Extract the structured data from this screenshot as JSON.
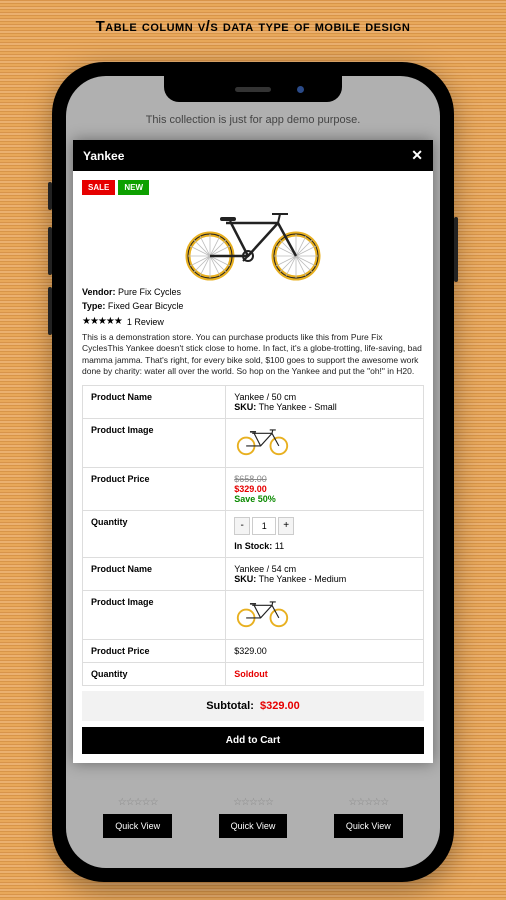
{
  "page_title": "Table column v/s data type of mobile design",
  "demo_notice": "This collection is just for app demo purpose.",
  "modal": {
    "title": "Yankee",
    "badges": {
      "sale": "SALE",
      "new": "NEW"
    },
    "vendor_label": "Vendor:",
    "vendor_value": "Pure Fix Cycles",
    "type_label": "Type:",
    "type_value": "Fixed Gear Bicycle",
    "review_count": "1 Review",
    "description": "This is a demonstration store. You can purchase products like this from Pure Fix CyclesThis Yankee doesn't stick close to home. In fact, it's a globe-trotting, life-saving, bad mamma jamma. That's right, for every bike sold, $100 goes to support the awesome work done by charity: water all over the world. So hop on the Yankee and put the \"oh!\" in H20.",
    "labels": {
      "product_name": "Product Name",
      "product_image": "Product Image",
      "product_price": "Product Price",
      "quantity": "Quantity",
      "sku": "SKU:",
      "instock": "In Stock:",
      "subtotal": "Subtotal:",
      "addcart": "Add to Cart"
    },
    "variants": [
      {
        "name": "Yankee / 50 cm",
        "sku": "The Yankee - Small",
        "old_price": "$658.00",
        "price": "$329.00",
        "save": "Save 50%",
        "qty": "1",
        "stock": "11"
      },
      {
        "name": "Yankee / 54 cm",
        "sku": "The Yankee - Medium",
        "price": "$329.00",
        "soldout": "Soldout"
      }
    ],
    "subtotal_amount": "$329.00"
  },
  "bg_quickview": "Quick View"
}
